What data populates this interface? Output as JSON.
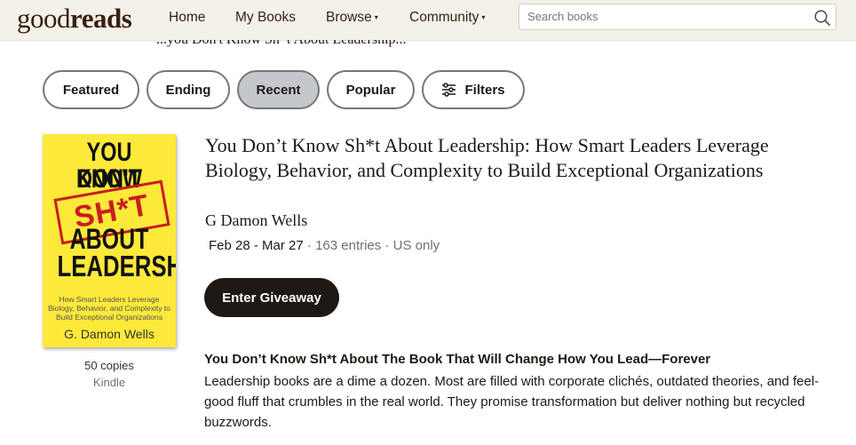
{
  "header": {
    "logo": {
      "part1": "good",
      "part2": "reads"
    },
    "nav": [
      {
        "label": "Home",
        "dropdown": false
      },
      {
        "label": "My Books",
        "dropdown": false
      },
      {
        "label": "Browse",
        "dropdown": true
      },
      {
        "label": "Community",
        "dropdown": true
      }
    ],
    "search": {
      "placeholder": "Search books",
      "value": ""
    },
    "caret": "▾"
  },
  "partial_text": "...you Don't Know Sh*t About Leadership...",
  "filters": {
    "tabs": [
      {
        "label": "Featured",
        "active": false
      },
      {
        "label": "Ending",
        "active": false
      },
      {
        "label": "Recent",
        "active": true
      },
      {
        "label": "Popular",
        "active": false
      }
    ],
    "filters_label": "Filters"
  },
  "giveaway": {
    "cover": {
      "line1": "YOU DON'T",
      "line2": "KNOW",
      "stamp": "SH*T",
      "line3": "ABOUT",
      "line4": "LEADERSHIP",
      "subtitle": "How Smart Leaders Leverage Biology, Behavior, and Complexity to Build Exceptional Organizations",
      "author": "G. Damon Wells",
      "color": "#fde93a"
    },
    "copies": "50 copies",
    "format": "Kindle",
    "title": "You Don’t Know Sh*t About Leadership: How Smart Leaders Leverage Biology, Behavior, and Complexity to Build Exceptional Organizations",
    "author": "G Damon Wells",
    "dates": "Feb 28 - Mar 27",
    "entries": "163 entries",
    "region": "US only",
    "separator": "·",
    "enter_label": "Enter Giveaway",
    "description_heading": "You Don’t Know Sh*t About The Book That Will Change How You Lead—Forever",
    "description": "Leadership books are a dime a dozen. Most are filled with corporate clichés, outdated theories, and feel-good fluff that crumbles in the real world. They promise transformation but deliver nothing but recycled buzzwords."
  },
  "colors": {
    "header_bg": "#f4f1ea",
    "brand_brown": "#382110",
    "dark_button": "#1e1915",
    "active_pill": "#c4c7cb",
    "muted_text": "#707070"
  }
}
